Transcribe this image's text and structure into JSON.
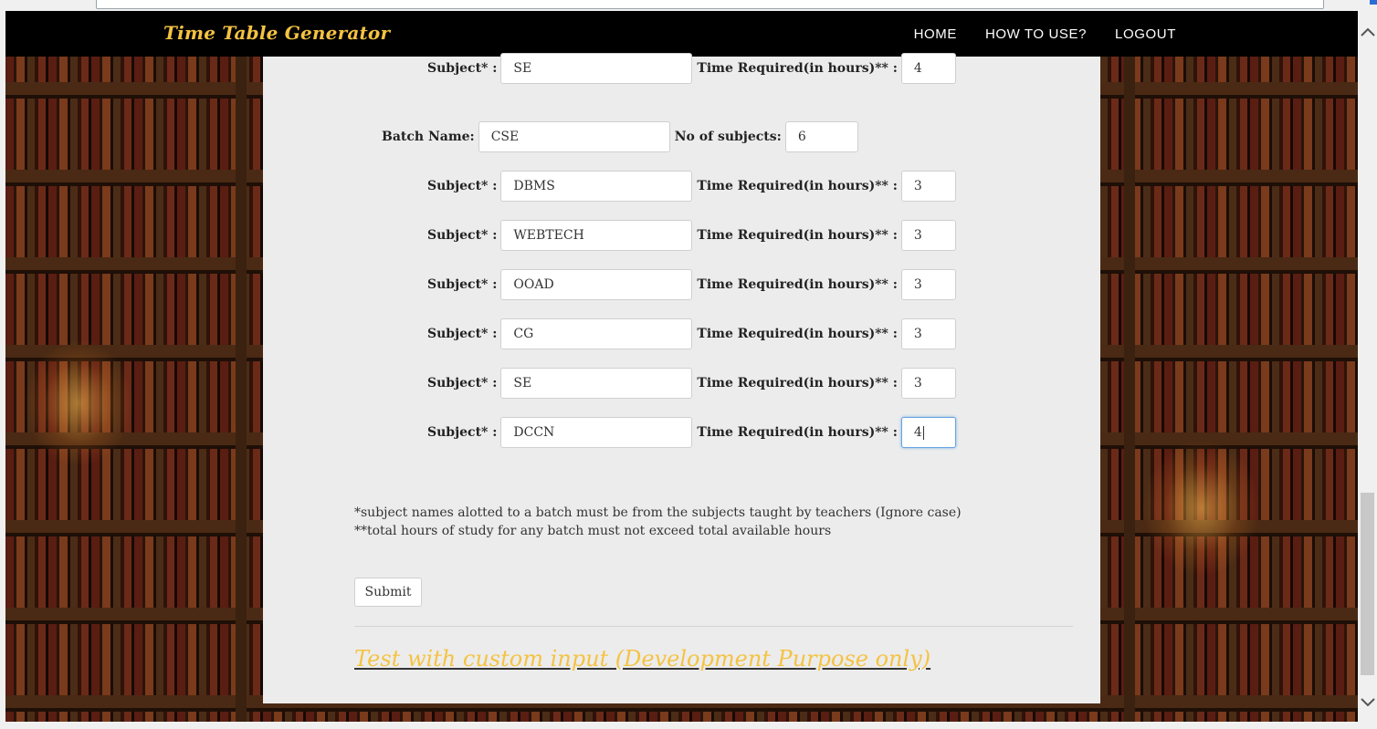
{
  "navbar": {
    "brand": "Time Table Generator",
    "links": [
      "HOME",
      "HOW TO USE?",
      "LOGOUT"
    ]
  },
  "form": {
    "subject_label": "Subject* :",
    "hours_label": "Time Required(in hours)** :",
    "batch_label": "Batch Name:",
    "count_label": "No of subjects:",
    "prev_row": {
      "subject": "SE",
      "hours": "4"
    },
    "batch": {
      "name": "CSE",
      "num_subjects": "6",
      "rows": [
        {
          "subject": "DBMS",
          "hours": "3"
        },
        {
          "subject": "WEBTECH",
          "hours": "3"
        },
        {
          "subject": "OOAD",
          "hours": "3"
        },
        {
          "subject": "CG",
          "hours": "3"
        },
        {
          "subject": "SE",
          "hours": "3"
        },
        {
          "subject": "DCCN",
          "hours": "4"
        }
      ]
    }
  },
  "notes": {
    "line1": "*subject names alotted to a batch must be from the subjects taught by teachers (Ignore case)",
    "line2": "**total hours of study for any batch must not exceed total available hours"
  },
  "submit_label": "Submit",
  "custom_link": "Test with custom input (Development Purpose only)",
  "colors": {
    "navbar": "#000000",
    "brand": "#f5c342",
    "panel": "#ececec",
    "focus": "#66a3e0"
  }
}
